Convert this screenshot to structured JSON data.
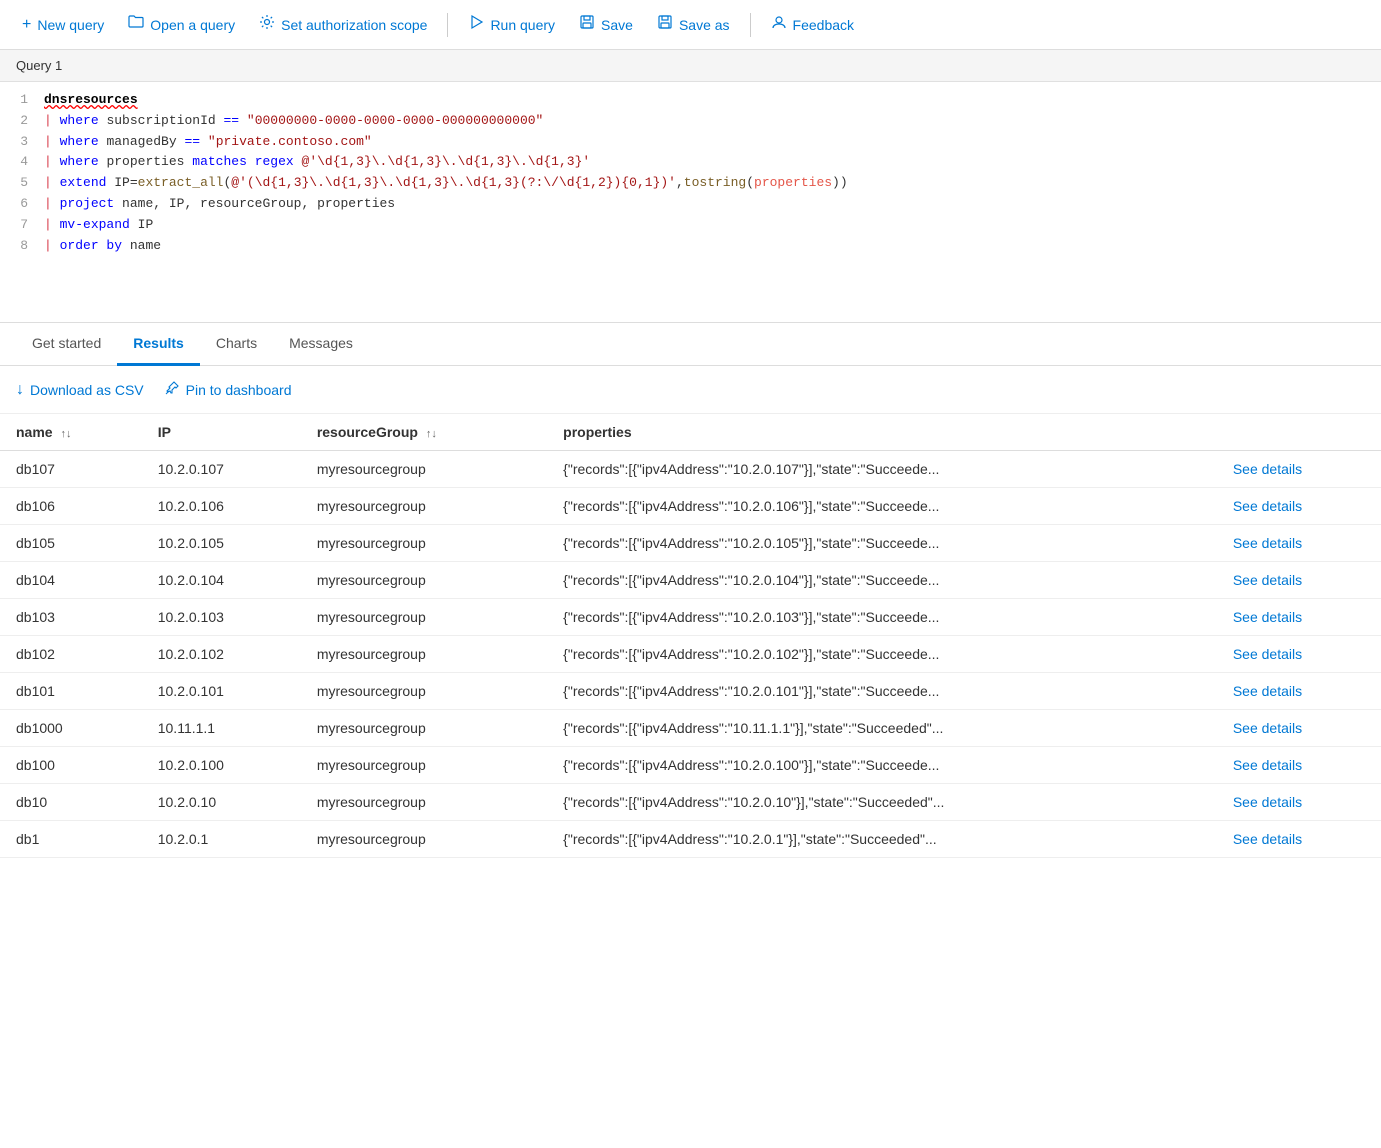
{
  "toolbar": {
    "new_query_label": "New query",
    "open_query_label": "Open a query",
    "set_auth_label": "Set authorization scope",
    "run_query_label": "Run query",
    "save_label": "Save",
    "save_as_label": "Save as",
    "feedback_label": "Feedback"
  },
  "editor": {
    "title": "Query 1",
    "lines": [
      {
        "num": "1",
        "content_raw": "dnsresources"
      },
      {
        "num": "2",
        "content_raw": "| where subscriptionId == \"00000000-0000-0000-0000-000000000000\""
      },
      {
        "num": "3",
        "content_raw": "| where managedBy == \"private.contoso.com\""
      },
      {
        "num": "4",
        "content_raw": "| where properties matches regex @'\\d{1,3}\\.\\d{1,3}\\.\\d{1,3}\\.\\d{1,3}'"
      },
      {
        "num": "5",
        "content_raw": "| extend IP=extract_all(@'(\\d{1,3}\\.\\d{1,3}\\.\\d{1,3}\\.\\d{1,3}(?:\\/\\d{1,2}){0,1})',tostring(properties))"
      },
      {
        "num": "6",
        "content_raw": "| project  name, IP, resourceGroup, properties"
      },
      {
        "num": "7",
        "content_raw": "| mv-expand IP"
      },
      {
        "num": "8",
        "content_raw": "| order by name"
      }
    ]
  },
  "results": {
    "tabs": [
      {
        "id": "get-started",
        "label": "Get started",
        "active": false
      },
      {
        "id": "results",
        "label": "Results",
        "active": true
      },
      {
        "id": "charts",
        "label": "Charts",
        "active": false
      },
      {
        "id": "messages",
        "label": "Messages",
        "active": false
      }
    ],
    "download_csv_label": "Download as CSV",
    "pin_to_dashboard_label": "Pin to dashboard",
    "columns": [
      {
        "id": "name",
        "label": "name",
        "sortable": true
      },
      {
        "id": "ip",
        "label": "IP",
        "sortable": false
      },
      {
        "id": "resourceGroup",
        "label": "resourceGroup",
        "sortable": true
      },
      {
        "id": "properties",
        "label": "properties",
        "sortable": false
      }
    ],
    "rows": [
      {
        "name": "db107",
        "ip": "10.2.0.107",
        "resourceGroup": "myresourcegroup",
        "properties": "{\"records\":[{\"ipv4Address\":\"10.2.0.107\"}],\"state\":\"Succeede..."
      },
      {
        "name": "db106",
        "ip": "10.2.0.106",
        "resourceGroup": "myresourcegroup",
        "properties": "{\"records\":[{\"ipv4Address\":\"10.2.0.106\"}],\"state\":\"Succeede..."
      },
      {
        "name": "db105",
        "ip": "10.2.0.105",
        "resourceGroup": "myresourcegroup",
        "properties": "{\"records\":[{\"ipv4Address\":\"10.2.0.105\"}],\"state\":\"Succeede..."
      },
      {
        "name": "db104",
        "ip": "10.2.0.104",
        "resourceGroup": "myresourcegroup",
        "properties": "{\"records\":[{\"ipv4Address\":\"10.2.0.104\"}],\"state\":\"Succeede..."
      },
      {
        "name": "db103",
        "ip": "10.2.0.103",
        "resourceGroup": "myresourcegroup",
        "properties": "{\"records\":[{\"ipv4Address\":\"10.2.0.103\"}],\"state\":\"Succeede..."
      },
      {
        "name": "db102",
        "ip": "10.2.0.102",
        "resourceGroup": "myresourcegroup",
        "properties": "{\"records\":[{\"ipv4Address\":\"10.2.0.102\"}],\"state\":\"Succeede..."
      },
      {
        "name": "db101",
        "ip": "10.2.0.101",
        "resourceGroup": "myresourcegroup",
        "properties": "{\"records\":[{\"ipv4Address\":\"10.2.0.101\"}],\"state\":\"Succeede..."
      },
      {
        "name": "db1000",
        "ip": "10.11.1.1",
        "resourceGroup": "myresourcegroup",
        "properties": "{\"records\":[{\"ipv4Address\":\"10.11.1.1\"}],\"state\":\"Succeeded\"..."
      },
      {
        "name": "db100",
        "ip": "10.2.0.100",
        "resourceGroup": "myresourcegroup",
        "properties": "{\"records\":[{\"ipv4Address\":\"10.2.0.100\"}],\"state\":\"Succeede..."
      },
      {
        "name": "db10",
        "ip": "10.2.0.10",
        "resourceGroup": "myresourcegroup",
        "properties": "{\"records\":[{\"ipv4Address\":\"10.2.0.10\"}],\"state\":\"Succeeded\"..."
      },
      {
        "name": "db1",
        "ip": "10.2.0.1",
        "resourceGroup": "myresourcegroup",
        "properties": "{\"records\":[{\"ipv4Address\":\"10.2.0.1\"}],\"state\":\"Succeeded\"..."
      }
    ],
    "see_details_label": "See details"
  },
  "icons": {
    "plus": "+",
    "folder": "📂",
    "gear": "⚙",
    "play": "▷",
    "save": "💾",
    "feedback": "👤",
    "download": "↓",
    "pin": "📌"
  }
}
